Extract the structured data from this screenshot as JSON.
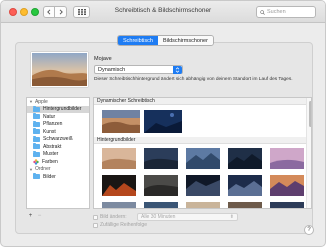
{
  "window": {
    "title": "Schreibtisch & Bildschirmschoner"
  },
  "toolbar": {
    "search_placeholder": "Suchen",
    "back_icon": "chevron-left-icon",
    "forward_icon": "chevron-right-icon",
    "grid_icon": "grid-icon"
  },
  "tabs": [
    {
      "label": "Schreibtisch",
      "active": true
    },
    {
      "label": "Bildschirmschoner",
      "active": false
    }
  ],
  "current": {
    "name": "Mojave",
    "mode": "Dynamisch",
    "description": "Dieser Schreibtischhintergrund ändert sich abhängig von deinem Standort im Lauf des Tages."
  },
  "sidebar": {
    "groups": [
      {
        "label": "Apple",
        "items": [
          "Hintergrundbilder",
          "Natur",
          "Pflanzen",
          "Kunst",
          "Schwarzweiß",
          "Abstrakt",
          "Muster",
          "Farben"
        ],
        "selected": "Hintergrundbilder"
      },
      {
        "label": "Ordner",
        "items": [
          "Bilder"
        ]
      }
    ],
    "add_label": "+",
    "remove_label": "−"
  },
  "sections": {
    "dynamic_title": "Dynamischer Schreibtisch",
    "wallpapers_title": "Hintergrundbilder"
  },
  "options": {
    "change_picture_label": "Bild ändern:",
    "interval_value": "Alle 30 Minuten",
    "random_order_label": "Zufällige Reihenfolge"
  },
  "help_label": "?",
  "colors": {
    "accent": "#1e7cf3",
    "folder": "#5fb2ef"
  }
}
